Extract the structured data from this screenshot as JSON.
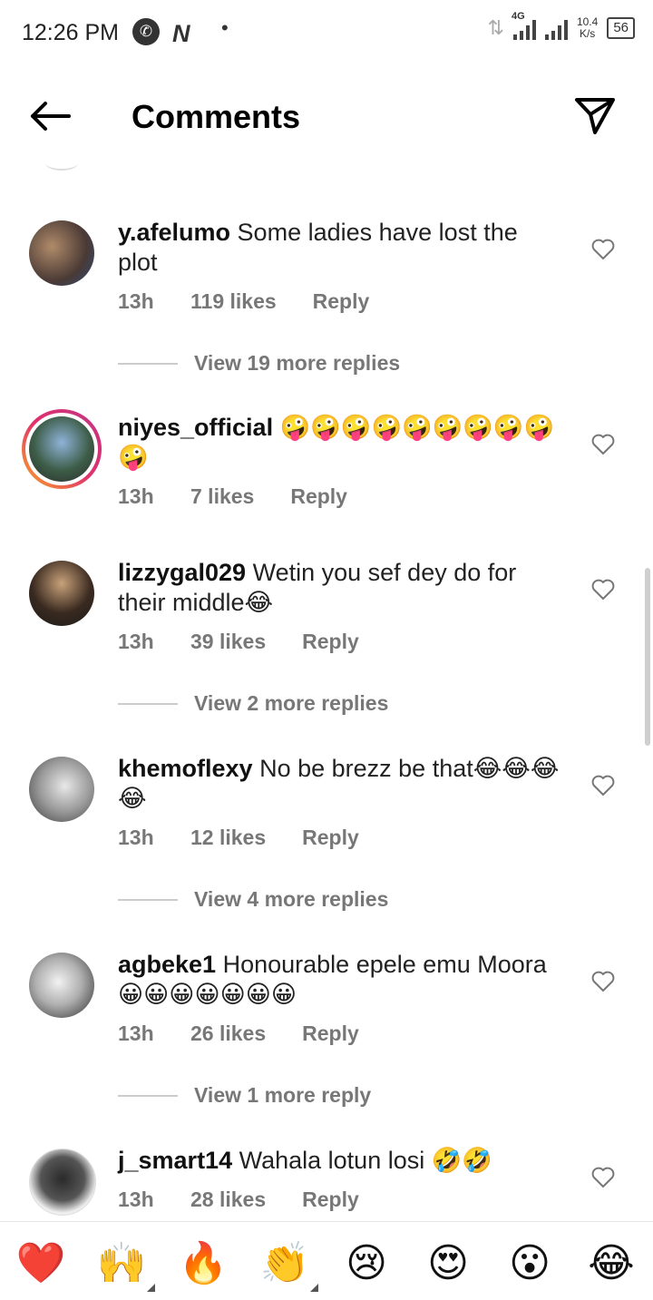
{
  "status_bar": {
    "time": "12:26 PM",
    "network": "4G",
    "speed_value": "10.4",
    "speed_unit": "K/s",
    "battery": "56"
  },
  "header": {
    "title": "Comments"
  },
  "comments": [
    {
      "username": "y.afelumo",
      "text": "Some ladies have lost the plot",
      "time": "13h",
      "likes": "119 likes",
      "reply": "Reply",
      "more": "View 19 more replies"
    },
    {
      "username": "niyes_official",
      "text": "🤪🤪🤪🤪🤪🤪🤪🤪🤪🤪",
      "time": "13h",
      "likes": "7 likes",
      "reply": "Reply"
    },
    {
      "username": "lizzygal029",
      "text": "Wetin you sef dey do for their middle😂",
      "time": "13h",
      "likes": "39 likes",
      "reply": "Reply",
      "more": "View 2 more replies"
    },
    {
      "username": "khemoflexy",
      "text": "No be brezz be that😂😂😂😂",
      "time": "13h",
      "likes": "12 likes",
      "reply": "Reply",
      "more": "View 4 more replies"
    },
    {
      "username": "agbeke1",
      "text": "Honourable epele emu Moora 😀😀😀😀😀😀😀",
      "time": "13h",
      "likes": "26 likes",
      "reply": "Reply",
      "more": "View 1 more reply"
    },
    {
      "username": "j_smart14",
      "text": "Wahala lotun losi 🤣🤣",
      "time": "13h",
      "likes": "28 likes",
      "reply": "Reply"
    }
  ],
  "emoji_bar": [
    "❤️",
    "🙌",
    "🔥",
    "👏",
    "😢",
    "😍",
    "😮",
    "😂"
  ],
  "colors": {
    "accent_story_ring": "#e1306c",
    "muted_text": "#777777"
  }
}
